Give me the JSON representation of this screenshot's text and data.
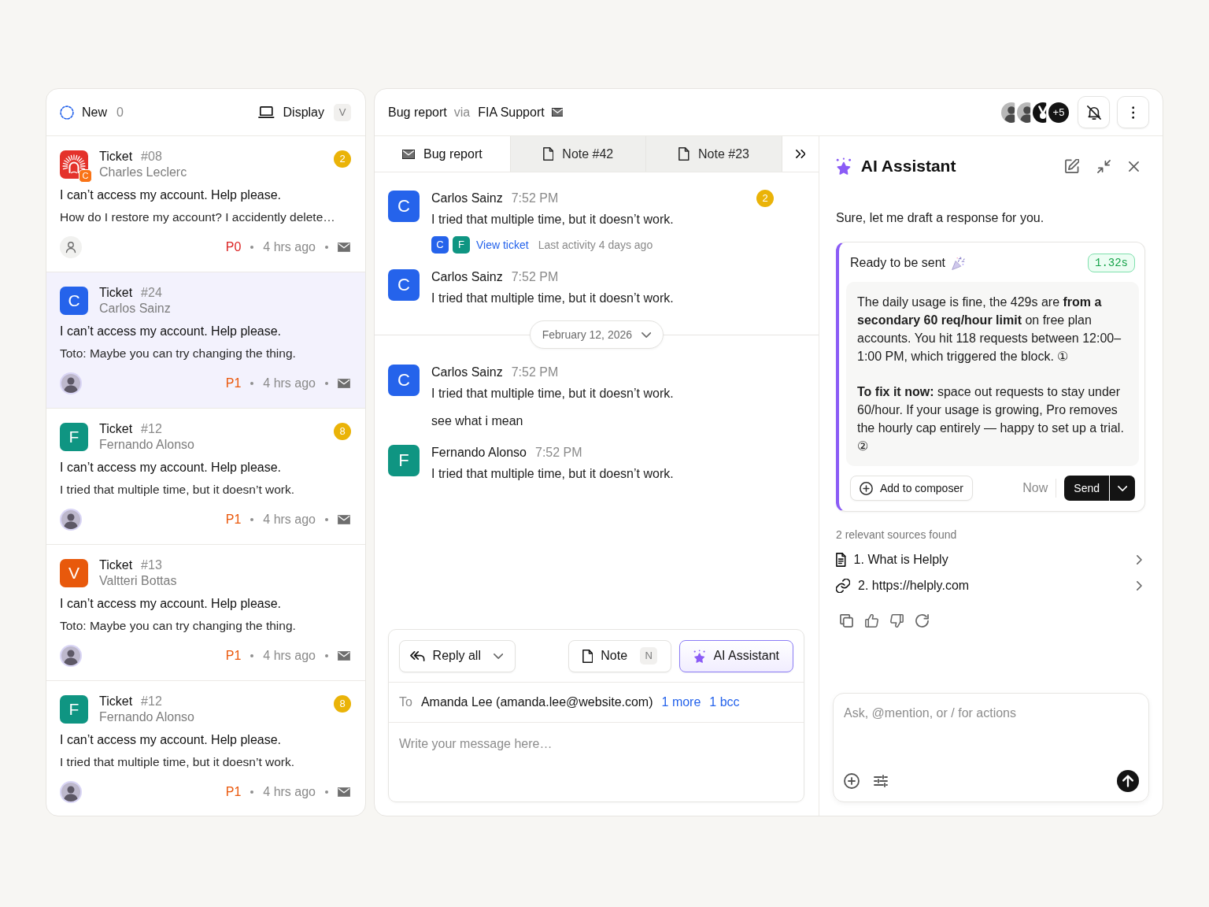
{
  "ticket_list": {
    "title": "New",
    "count": "0",
    "display": {
      "label": "Display",
      "shortcut": "V"
    },
    "tickets": [
      {
        "selected": false,
        "label": "Ticket",
        "number": "#08",
        "customer": "Charles Leclerc",
        "avatar": {
          "kind": "logo",
          "badge": "C"
        },
        "unread": "2",
        "subject": "I can’t access my account. Help please.",
        "preview": "How do I restore my account? I accidently delete…",
        "assignee": {
          "kind": "unassigned"
        },
        "priority": {
          "label": "P0",
          "color": "#dc2626"
        },
        "time": "4 hrs ago"
      },
      {
        "selected": true,
        "label": "Ticket",
        "number": "#24",
        "customer": "Carlos Sainz",
        "avatar": {
          "kind": "letter",
          "letter": "C",
          "color": "#2563eb"
        },
        "subject": "I can’t access my account. Help please.",
        "preview": "Toto: Maybe you can try changing the thing.",
        "assignee": {
          "kind": "photo"
        },
        "priority": {
          "label": "P1",
          "color": "#ea580c"
        },
        "time": "4 hrs ago"
      },
      {
        "selected": false,
        "label": "Ticket",
        "number": "#12",
        "customer": "Fernando Alonso",
        "avatar": {
          "kind": "letter",
          "letter": "F",
          "color": "#0f9582"
        },
        "unread": "8",
        "subject": "I can’t access my account. Help please.",
        "preview": "I tried that multiple time, but it doesn’t work.",
        "assignee": {
          "kind": "photo"
        },
        "priority": {
          "label": "P1",
          "color": "#ea580c"
        },
        "time": "4 hrs ago"
      },
      {
        "selected": false,
        "label": "Ticket",
        "number": "#13",
        "customer": "Valtteri Bottas",
        "avatar": {
          "kind": "letter",
          "letter": "V",
          "color": "#e8590c"
        },
        "subject": "I can’t access my account. Help please.",
        "preview": "Toto: Maybe you can try changing the thing.",
        "assignee": {
          "kind": "photo"
        },
        "priority": {
          "label": "P1",
          "color": "#ea580c"
        },
        "time": "4 hrs ago"
      },
      {
        "selected": false,
        "label": "Ticket",
        "number": "#12",
        "customer": "Fernando Alonso",
        "avatar": {
          "kind": "letter",
          "letter": "F",
          "color": "#0f9582"
        },
        "unread": "8",
        "subject": "I can’t access my account. Help please.",
        "preview": "I tried that multiple time, but it doesn’t work.",
        "assignee": {
          "kind": "photo"
        },
        "priority": {
          "label": "P1",
          "color": "#ea580c"
        },
        "time": "4 hrs ago"
      }
    ]
  },
  "conversation": {
    "subject": "Bug report",
    "via": "via",
    "channel": "FIA Support",
    "participants": [
      {
        "kind": "photo"
      },
      {
        "kind": "photo"
      },
      {
        "kind": "logo"
      }
    ],
    "participants_more": "+5",
    "tabs": [
      {
        "label": "Bug report",
        "kind": "email",
        "selected": true
      },
      {
        "label": "Note #42",
        "kind": "note",
        "selected": false
      },
      {
        "label": "Note #23",
        "kind": "note",
        "selected": false
      }
    ],
    "timeline": [
      {
        "kind": "message",
        "author": "Carlos Sainz",
        "time": "7:52 PM",
        "avatar": {
          "letter": "C",
          "color": "#2563eb"
        },
        "unread": "2",
        "texts": [
          "I tried that multiple time, but it doesn’t work."
        ],
        "thread": {
          "avatars": [
            {
              "letter": "C",
              "color": "#2563eb"
            },
            {
              "letter": "F",
              "color": "#0f9582"
            }
          ],
          "link": "View ticket",
          "activity": "Last activity 4 days ago"
        }
      },
      {
        "kind": "message",
        "author": "Carlos Sainz",
        "time": "7:52 PM",
        "avatar": {
          "letter": "C",
          "color": "#2563eb"
        },
        "texts": [
          "I tried that multiple time, but it doesn’t work."
        ]
      },
      {
        "kind": "date",
        "label": "February 12, 2026"
      },
      {
        "kind": "message",
        "author": "Carlos Sainz",
        "time": "7:52 PM",
        "avatar": {
          "letter": "C",
          "color": "#2563eb"
        },
        "texts": [
          "I tried that multiple time, but it doesn’t work.",
          "see what i mean"
        ]
      },
      {
        "kind": "message",
        "author": "Fernando Alonso",
        "time": "7:52 PM",
        "avatar": {
          "letter": "F",
          "color": "#0f9582"
        },
        "texts": [
          "I tried that multiple time, but it doesn’t work."
        ]
      }
    ],
    "composer": {
      "reply_mode": "Reply all",
      "modes": [
        {
          "kind": "note",
          "label": "Note",
          "shortcut": "N",
          "selected": false
        },
        {
          "kind": "ai",
          "label": "AI Assistant",
          "selected": true
        }
      ],
      "to_label": "To",
      "recipient": "Amanda Lee (amanda.lee@website.com)",
      "links": [
        "1 more",
        "1 bcc"
      ],
      "placeholder": "Write your message here…"
    }
  },
  "assistant": {
    "title": "AI Assistant",
    "intro": "Sure, let me draft a response for you.",
    "draft": {
      "status": "Ready to be sent",
      "duration": "1.32s",
      "paragraphs": [
        "The daily usage is fine, the 429s are **from a secondary 60 req/hour limit** on free plan accounts. You hit 118 requests between 12:00–1:00 PM, which triggered the block. ①",
        "**To fix it now:** space out requests to stay under 60/hour. If your usage is growing, Pro removes the hourly cap entirely — happy to set up a trial. ②"
      ],
      "add_label": "Add to composer",
      "send_time": "Now",
      "send_label": "Send"
    },
    "sources_label": "2 relevant sources found",
    "sources": [
      {
        "kind": "document",
        "label": "1. What is Helply"
      },
      {
        "kind": "link",
        "label": "2. https://helply.com"
      }
    ],
    "input": {
      "placeholder": "Ask, @mention, or / for actions"
    }
  }
}
